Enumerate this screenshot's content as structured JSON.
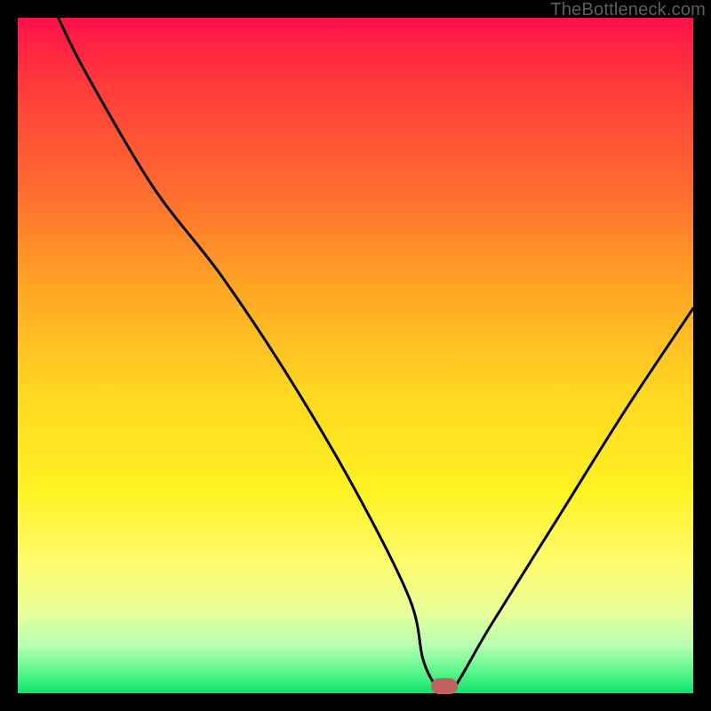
{
  "watermark": "TheBottleneck.com",
  "colors": {
    "background": "#000000",
    "marker": "#c0625f",
    "curve": "#000000"
  },
  "chart_data": {
    "type": "line",
    "title": "",
    "xlabel": "",
    "ylabel": "",
    "xlim": [
      0,
      100
    ],
    "ylim": [
      0,
      100
    ],
    "grid": false,
    "series": [
      {
        "name": "bottleneck-curve",
        "x": [
          6,
          10,
          20,
          30,
          40,
          50,
          58,
          60,
          62,
          64,
          70,
          80,
          90,
          100
        ],
        "values": [
          100,
          92,
          75,
          62,
          47,
          30,
          14,
          5,
          1,
          0,
          10,
          26,
          42,
          57
        ]
      }
    ],
    "marker": {
      "x": 63.2,
      "y": 1.0
    },
    "background_gradient": {
      "direction": "vertical",
      "stops": [
        {
          "pos": 0.0,
          "color": "#ff114a"
        },
        {
          "pos": 0.1,
          "color": "#ff3b3b"
        },
        {
          "pos": 0.25,
          "color": "#ff6a2f"
        },
        {
          "pos": 0.4,
          "color": "#ffa624"
        },
        {
          "pos": 0.55,
          "color": "#ffd622"
        },
        {
          "pos": 0.7,
          "color": "#fff223"
        },
        {
          "pos": 0.8,
          "color": "#fffb6a"
        },
        {
          "pos": 0.88,
          "color": "#e9ff9a"
        },
        {
          "pos": 0.93,
          "color": "#b6ffb3"
        },
        {
          "pos": 0.97,
          "color": "#56f58a"
        },
        {
          "pos": 1.0,
          "color": "#0be36e"
        }
      ]
    }
  }
}
